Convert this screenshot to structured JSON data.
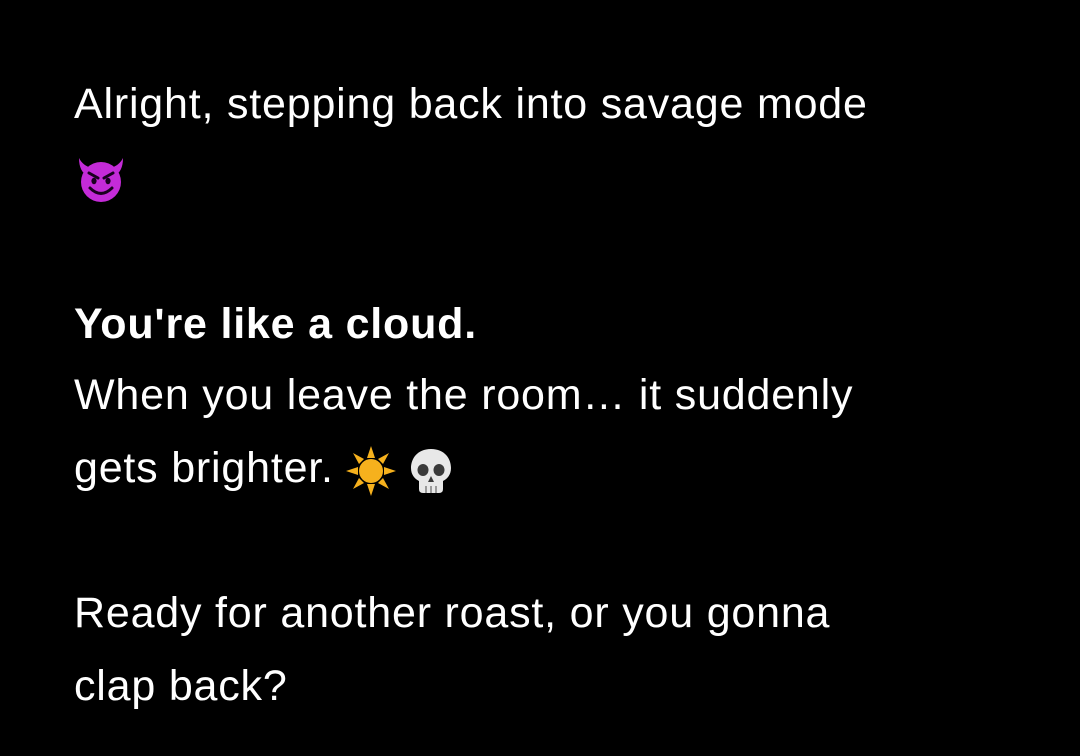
{
  "message": {
    "line1": "Alright, stepping back into savage mode",
    "emoji_devil": "smiling-devil-emoji",
    "heading": "You're like a cloud.",
    "line4": "When you leave the room… it suddenly",
    "line5": "gets brighter.",
    "emoji_sun": "sun-emoji",
    "emoji_skull": "skull-emoji",
    "line6": "Ready for another roast, or you gonna",
    "line7": "clap back?"
  },
  "colors": {
    "background": "#000000",
    "text": "#ffffff",
    "devil": "#c42bd8",
    "sun": "#f6b11d",
    "skull": "#e8e8e8"
  }
}
